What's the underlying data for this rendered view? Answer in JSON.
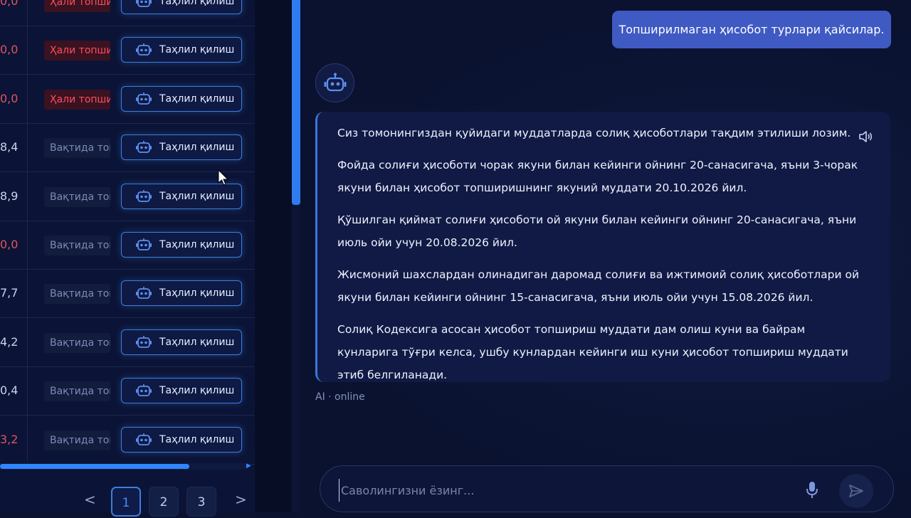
{
  "table": {
    "rows": [
      {
        "value": "0,0",
        "negative": true,
        "status": "Ҳали топши",
        "status_type": "late",
        "action": "Таҳлил қилиш"
      },
      {
        "value": "0,0",
        "negative": true,
        "status": "Ҳали топши",
        "status_type": "late",
        "action": "Таҳлил қилиш"
      },
      {
        "value": "0,0",
        "negative": true,
        "status": "Ҳали топши",
        "status_type": "late",
        "action": "Таҳлил қилиш"
      },
      {
        "value": "8,4",
        "negative": false,
        "status": "Вақтида топ",
        "status_type": "ok",
        "action": "Таҳлил қилиш"
      },
      {
        "value": "8,9",
        "negative": false,
        "status": "Вақтида топ",
        "status_type": "ok",
        "action": "Таҳлил қилиш"
      },
      {
        "value": "0,0",
        "negative": true,
        "status": "Вақтида топ",
        "status_type": "ok",
        "action": "Таҳлил қилиш"
      },
      {
        "value": "7,7",
        "negative": false,
        "status": "Вақтида топ",
        "status_type": "ok",
        "action": "Таҳлил қилиш"
      },
      {
        "value": "4,2",
        "negative": false,
        "status": "Вақтида топ",
        "status_type": "ok",
        "action": "Таҳлил қилиш"
      },
      {
        "value": "0,4",
        "negative": false,
        "status": "Вақтида топ",
        "status_type": "ok",
        "action": "Таҳлил қилиш"
      },
      {
        "value": "3,2",
        "negative": true,
        "status": "Вақтида топ",
        "status_type": "ok",
        "action": "Таҳлил қилиш"
      }
    ]
  },
  "pagination": {
    "prev": "<",
    "next": ">",
    "pages": [
      "1",
      "2",
      "3"
    ],
    "current": "1"
  },
  "chat": {
    "user_message": "Топширилмаган ҳисобот турлари қайсилар.",
    "bot_paragraphs": [
      "Сиз томонингиздан қуйидаги муддатларда солиқ ҳисоботлари тақдим этилиши лозим.",
      "Фойда солиғи ҳисоботи чорак якуни билан кейинги ойнинг 20-санасигача, яъни 3-чорак якуни билан ҳисобот топширишнинг якуний муддати 20.10.2026 йил.",
      "Қўшилган қиймат солиғи ҳисоботи ой якуни билан кейинги ойнинг 20-санасигача, яъни июль ойи учун 20.08.2026 йил.",
      "Жисмоний шахслардан олинадиган даромад солиғи ва ижтимоий солиқ ҳисоботлари ой якуни билан кейинги ойнинг 15-санасигача, яъни июль ойи учун 15.08.2026 йил.",
      "Солиқ Кодексига асосан ҳисобот топшириш муддати дам олиш куни ва байрам кунларига тўғри келса, ушбу кунлардан кейинги иш куни ҳисобот топшириш муддати этиб белгиланади."
    ],
    "bot_status": "AI · online",
    "input_placeholder": "Саволингизни ёзинг...",
    "icons": {
      "bot": "robot-icon",
      "speaker": "speaker-icon",
      "mic": "microphone-icon",
      "send": "send-icon"
    }
  },
  "colors": {
    "accent": "#3d7ee0",
    "late": "#ff4d5e",
    "user_bubble": "#3f5ac3"
  }
}
